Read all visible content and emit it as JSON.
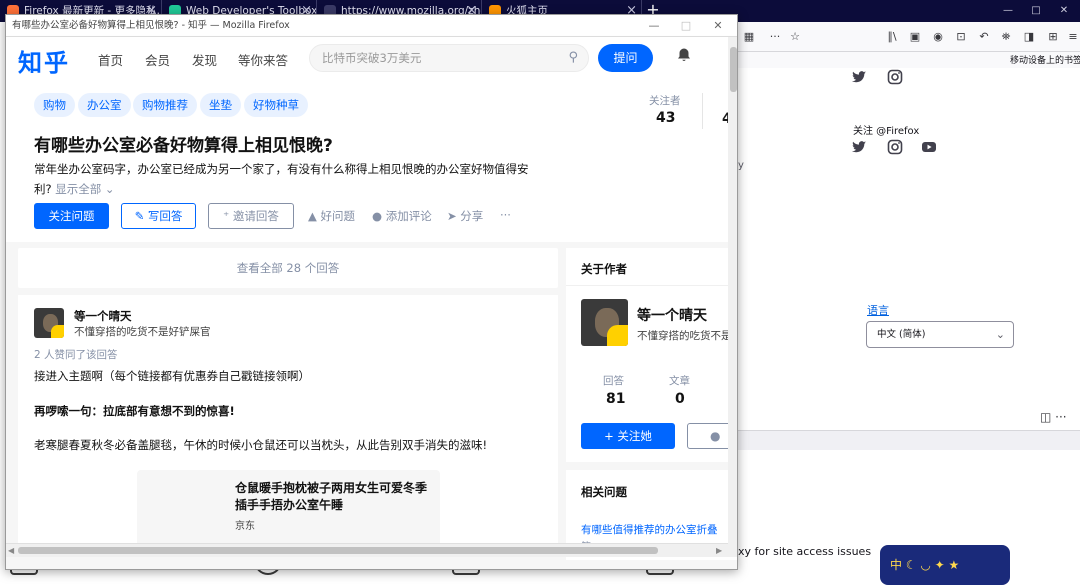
{
  "browser": {
    "tabs": [
      {
        "title": "Firefox 最新更新 - 更多隐私…",
        "color": "#ff7139"
      },
      {
        "title": "Web Developer's Toolbox",
        "color": "#20c997"
      },
      {
        "title": "https://www.mozilla.org/zh-CN/",
        "color": "#0c0c3a"
      },
      {
        "title": "火狐主页",
        "color": "#ff9500"
      }
    ],
    "tab_close": "×",
    "new_tab": "+",
    "window_controls": [
      "—",
      "□",
      "✕"
    ],
    "toolbar": {
      "qr": "▦",
      "more": "···",
      "star": "☆",
      "icons": [
        "∥\\",
        "▣",
        "◉",
        "⊡",
        "↶",
        "⛯",
        "◨",
        "⊞",
        "≡"
      ]
    },
    "bookmarks": {
      "mobile": "移动设备上的书签"
    },
    "page": {
      "follow_label": "关注 @Firefox",
      "fragment_y": "y",
      "language_label": "语言",
      "language_value": "中文 (简体)",
      "bottom_text": "xy for site access issues",
      "bottom_frag1": "y",
      "bottom_frag2": "g",
      "bottom_frag3": "p",
      "bottom_frag4": "p",
      "promo": "中 ☾ ◡ ✦ ★"
    },
    "panel_tools": "◫ ···"
  },
  "popup": {
    "window_title": "有哪些办公室必备好物算得上相见恨晚? - 知乎 — Mozilla Firefox",
    "controls": [
      "—",
      "□",
      "✕"
    ],
    "zhihu": {
      "logo": "知乎",
      "nav": [
        "首页",
        "会员",
        "发现",
        "等你来答"
      ],
      "search_placeholder": "比特币突破3万美元",
      "ask_button": "提问",
      "question": {
        "topics": [
          "购物",
          "办公室",
          "购物推荐",
          "坐垫",
          "好物种草"
        ],
        "title": "有哪些办公室必备好物算得上相见恨晚?",
        "description": "常年坐办公室码字，办公室已经成为另一个家了，有没有什么称得上相见恨晚的办公室好物值得安利? ",
        "show_all": "显示全部 ⌄",
        "follower_label": "关注者",
        "follower_count": "43",
        "frag_count": "4",
        "follow_button": "关注问题",
        "write_button": "✎ 写回答",
        "invite_button": "⁺ 邀请回答",
        "actions": [
          "▲ 好问题",
          "● 添加评论",
          "➤ 分享",
          "···"
        ]
      },
      "view_all": "查看全部 28 个回答",
      "answer": {
        "author": "等一个晴天",
        "bio": "不懂穿搭的吃货不是好铲屎官",
        "votes": "2 人赞同了该回答",
        "p1": "接进入主题啊（每个链接都有优惠券自己戳链接领啊）",
        "p2": "再啰嗦一句：拉底部有意想不到的惊喜!",
        "p3": "老寒腿春夏秋冬必备盖腿毯，午休的时候小仓鼠还可以当枕头，从此告别双手消失的滋味!",
        "card_title": "仓鼠暖手抱枕被子两用女生可爱冬季插手手捂办公室午睡",
        "card_source": "京东"
      },
      "sidebar": {
        "about_heading": "关于作者",
        "name": "等一个晴天",
        "bio": "不懂穿搭的吃货不是好铲",
        "stats": [
          {
            "label": "回答",
            "value": "81"
          },
          {
            "label": "文章",
            "value": "0"
          }
        ],
        "follow_button": "+ 关注她",
        "msg_icon": "●",
        "related_heading": "相关问题",
        "related_link": "有哪些值得推荐的办公室折叠",
        "related_frag": "答"
      }
    }
  }
}
